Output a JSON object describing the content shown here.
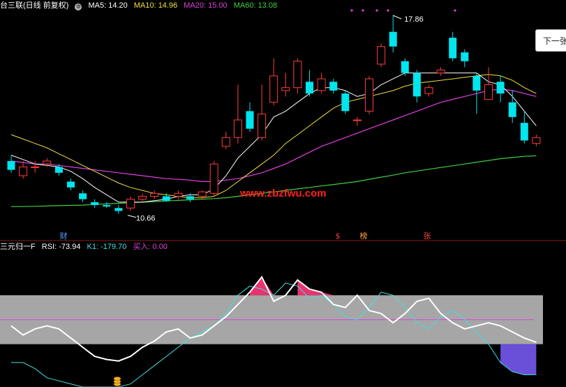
{
  "top_header": {
    "title": "台三联(日线 前复权)",
    "ma5": "MA5: 14.20",
    "ma10": "MA10: 14.96",
    "ma20": "MA20: 15.00",
    "ma60": "MA60: 13.08",
    "colors": {
      "title": "#ffffff",
      "ma5": "#ffffff",
      "ma10": "#f0e040",
      "ma20": "#e040e0",
      "ma60": "#40d040"
    }
  },
  "bottom_header": {
    "title": "三元归一F",
    "rsi": "RSI: -73.94",
    "k1": "K1: -179.70",
    "buy": "买入: 0.00",
    "colors": {
      "title": "#ffffff",
      "rsi": "#ffffff",
      "k1": "#40e0e0",
      "buy": "#e040e0"
    }
  },
  "next_button_label": "下一张",
  "watermark": "www.zbzfwu.com",
  "chart_data": [
    {
      "type": "candlestick",
      "annotations": {
        "high_label": "17.86",
        "low_label": "10.66"
      },
      "event_markers": [
        {
          "label": "财",
          "color": "#5a9cff"
        },
        {
          "label": "$",
          "color": "#ff4040"
        },
        {
          "label": "榜",
          "color": "#ffa040"
        },
        {
          "label": "张",
          "color": "#ff4040"
        }
      ],
      "candles": [
        [
          12.9,
          12.6,
          13.1,
          12.5
        ],
        [
          12.4,
          12.7,
          12.9,
          12.3
        ],
        [
          12.7,
          12.7,
          12.9,
          12.5
        ],
        [
          12.8,
          12.9,
          13.0,
          12.7
        ],
        [
          12.7,
          12.5,
          12.8,
          12.4
        ],
        [
          12.2,
          12.0,
          12.3,
          11.9
        ],
        [
          11.8,
          11.6,
          11.9,
          11.5
        ],
        [
          11.5,
          11.4,
          11.6,
          11.3
        ],
        [
          11.4,
          11.35,
          11.5,
          11.3
        ],
        [
          11.3,
          11.2,
          11.4,
          11.1
        ],
        [
          11.3,
          11.6,
          11.7,
          11.2
        ],
        [
          11.6,
          11.7,
          11.8,
          11.5
        ],
        [
          11.7,
          11.8,
          11.9,
          11.6
        ],
        [
          11.7,
          11.55,
          11.8,
          11.5
        ],
        [
          11.7,
          11.8,
          11.9,
          11.6
        ],
        [
          11.7,
          11.6,
          11.8,
          11.5
        ],
        [
          11.7,
          11.85,
          11.9,
          11.6
        ],
        [
          11.8,
          12.8,
          12.9,
          11.7
        ],
        [
          13.4,
          13.7,
          13.9,
          13.3
        ],
        [
          13.7,
          14.3,
          15.5,
          13.5
        ],
        [
          14.6,
          14.0,
          14.9,
          13.9
        ],
        [
          13.7,
          14.5,
          15.5,
          13.6
        ],
        [
          14.9,
          15.8,
          16.4,
          14.8
        ],
        [
          15.3,
          15.4,
          15.9,
          15.1
        ],
        [
          15.4,
          16.3,
          16.4,
          15.2
        ],
        [
          15.6,
          15.2,
          16.0,
          15.1
        ],
        [
          15.3,
          15.7,
          15.9,
          15.2
        ],
        [
          15.6,
          15.3,
          15.7,
          15.2
        ],
        [
          15.2,
          14.6,
          15.3,
          14.5
        ],
        [
          14.3,
          14.3,
          14.4,
          14.1
        ],
        [
          14.6,
          15.7,
          15.8,
          14.5
        ],
        [
          16.2,
          16.8,
          16.9,
          16.1
        ],
        [
          17.3,
          16.8,
          17.86,
          16.6
        ],
        [
          16.3,
          15.9,
          16.4,
          15.8
        ],
        [
          15.9,
          15.1,
          16.0,
          14.9
        ],
        [
          15.2,
          15.4,
          15.5,
          15.1
        ],
        [
          15.9,
          16.0,
          16.1,
          15.8
        ],
        [
          17.1,
          16.4,
          17.3,
          16.3
        ],
        [
          16.6,
          16.3,
          16.7,
          16.1
        ],
        [
          15.8,
          15.3,
          15.9,
          14.5
        ],
        [
          15.0,
          15.5,
          16.1,
          15.0
        ],
        [
          15.6,
          15.2,
          15.8,
          14.9
        ],
        [
          14.9,
          14.4,
          15.3,
          14.2
        ],
        [
          14.2,
          13.6,
          14.6,
          13.5
        ],
        [
          13.5,
          13.7,
          13.8,
          13.4
        ]
      ],
      "ma5": [
        13.1,
        12.95,
        12.8,
        12.75,
        12.7,
        12.55,
        12.3,
        12.0,
        11.75,
        11.5,
        11.5,
        11.5,
        11.55,
        11.6,
        11.7,
        11.75,
        11.75,
        11.95,
        12.4,
        13.0,
        13.4,
        13.8,
        14.4,
        14.6,
        14.9,
        15.2,
        15.4,
        15.4,
        15.3,
        15.1,
        15.2,
        15.5,
        15.7,
        15.9,
        15.9,
        15.9,
        15.9,
        15.9,
        15.9,
        15.9,
        15.6,
        15.5,
        15.1,
        14.6,
        14.1
      ],
      "ma10": [
        13.8,
        13.65,
        13.5,
        13.35,
        13.15,
        12.95,
        12.75,
        12.55,
        12.35,
        12.15,
        12.0,
        11.9,
        11.8,
        11.75,
        11.7,
        11.65,
        11.65,
        11.7,
        11.9,
        12.2,
        12.5,
        12.8,
        13.1,
        13.5,
        13.8,
        14.1,
        14.4,
        14.7,
        14.9,
        15.0,
        15.1,
        15.2,
        15.3,
        15.45,
        15.55,
        15.6,
        15.65,
        15.7,
        15.75,
        15.8,
        15.85,
        15.8,
        15.65,
        15.4,
        15.2
      ],
      "ma20": [
        12.9,
        12.85,
        12.8,
        12.8,
        12.75,
        12.7,
        12.65,
        12.6,
        12.55,
        12.5,
        12.45,
        12.4,
        12.35,
        12.3,
        12.28,
        12.25,
        12.2,
        12.2,
        12.25,
        12.3,
        12.4,
        12.5,
        12.65,
        12.8,
        13.0,
        13.2,
        13.4,
        13.55,
        13.7,
        13.85,
        14.0,
        14.15,
        14.3,
        14.45,
        14.6,
        14.75,
        14.9,
        15.0,
        15.1,
        15.2,
        15.3,
        15.35,
        15.3,
        15.2,
        15.1
      ],
      "ma60": [
        11.35,
        11.35,
        11.36,
        11.37,
        11.38,
        11.39,
        11.4,
        11.42,
        11.44,
        11.46,
        11.48,
        11.5,
        11.52,
        11.54,
        11.56,
        11.58,
        11.6,
        11.62,
        11.65,
        11.7,
        11.75,
        11.8,
        11.85,
        11.9,
        11.95,
        12.0,
        12.05,
        12.1,
        12.15,
        12.2,
        12.28,
        12.35,
        12.42,
        12.5,
        12.56,
        12.62,
        12.68,
        12.74,
        12.8,
        12.86,
        12.92,
        12.98,
        13.02,
        13.06,
        13.08
      ]
    },
    {
      "type": "line",
      "ylim": [
        -220,
        220
      ],
      "band": [
        -80,
        80
      ],
      "center_line": 0,
      "rsi": [
        -20,
        -50,
        -30,
        -20,
        -30,
        -60,
        -90,
        -120,
        -130,
        -135,
        -120,
        -90,
        -70,
        -40,
        -30,
        -60,
        -50,
        -20,
        10,
        50,
        90,
        140,
        60,
        80,
        130,
        100,
        90,
        50,
        40,
        80,
        30,
        20,
        -10,
        20,
        60,
        70,
        20,
        -10,
        -30,
        -20,
        -10,
        -20,
        -40,
        -60,
        -73.94
      ],
      "k1": [
        -140,
        -140,
        -160,
        -190,
        -200,
        -210,
        -220,
        -220,
        -220,
        -220,
        -210,
        -180,
        -150,
        -120,
        -90,
        -60,
        -40,
        -20,
        20,
        80,
        110,
        100,
        80,
        120,
        110,
        70,
        80,
        50,
        10,
        0,
        40,
        90,
        80,
        40,
        -10,
        -30,
        10,
        30,
        0,
        -40,
        -80,
        -140,
        -170,
        -180,
        -179.7
      ],
      "buy": [
        0,
        0,
        0,
        0,
        0,
        0,
        0,
        0,
        0,
        0,
        0,
        0,
        0,
        0,
        0,
        0,
        0,
        0,
        0,
        0,
        0,
        0,
        0,
        0,
        0,
        0,
        0,
        0,
        0,
        0,
        0,
        0,
        0,
        0,
        0,
        0,
        0,
        0,
        0,
        0,
        0,
        0,
        0,
        0,
        0
      ]
    }
  ]
}
